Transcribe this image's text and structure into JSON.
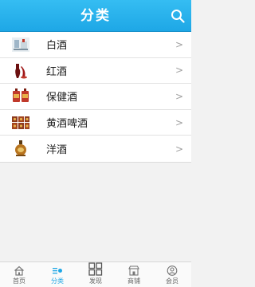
{
  "header": {
    "title": "分类",
    "search_icon": "search-icon"
  },
  "categories": [
    {
      "label": "白酒",
      "icon": "white-liquor-thumb"
    },
    {
      "label": "红酒",
      "icon": "red-wine-thumb"
    },
    {
      "label": "保健酒",
      "icon": "health-wine-thumb"
    },
    {
      "label": "黄酒啤酒",
      "icon": "yellow-wine-beer-thumb"
    },
    {
      "label": "洋酒",
      "icon": "foreign-liquor-thumb"
    }
  ],
  "row_arrow": ">",
  "tabbar": {
    "active_color": "#1ea7e6",
    "tabs": [
      {
        "label": "首页",
        "icon": "home-icon"
      },
      {
        "label": "分类",
        "icon": "category-list-icon"
      },
      {
        "label": "发现",
        "icon": "grid-icon"
      },
      {
        "label": "商铺",
        "icon": "shop-icon"
      },
      {
        "label": "会员",
        "icon": "user-icon"
      }
    ]
  }
}
